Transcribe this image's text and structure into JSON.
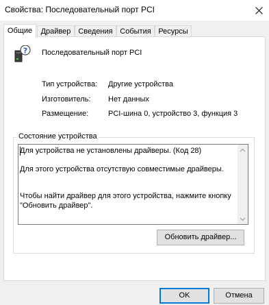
{
  "window": {
    "title": "Свойства: Последовательный порт PCI"
  },
  "tabs": [
    {
      "label": "Общие",
      "active": true
    },
    {
      "label": "Драйвер",
      "active": false
    },
    {
      "label": "Сведения",
      "active": false
    },
    {
      "label": "События",
      "active": false
    },
    {
      "label": "Ресурсы",
      "active": false
    }
  ],
  "device": {
    "name": "Последовательный порт PCI",
    "icon": "unknown-device-icon"
  },
  "properties": [
    {
      "label": "Тип устройства:",
      "value": "Другие устройства"
    },
    {
      "label": "Изготовитель:",
      "value": "Нет данных"
    },
    {
      "label": "Размещение:",
      "value": "PCI-шина 0, устройство 3, функция 3"
    }
  ],
  "status": {
    "group_label": "Состояние устройства",
    "lines": [
      "Для устройства не установлены драйверы. (Код 28)",
      "Для этого устройства отсутствую совместимые драйверы.",
      "Чтобы найти драйвер для этого устройства, нажмите кнопку",
      "\"Обновить драйвер\"."
    ]
  },
  "buttons": {
    "update_driver": "Обновить драйвер...",
    "ok": "OK",
    "cancel": "Отмена"
  },
  "colors": {
    "accent": "#0078d7",
    "panel_bg": "#ffffff",
    "dialog_bg": "#f0f0f0"
  }
}
